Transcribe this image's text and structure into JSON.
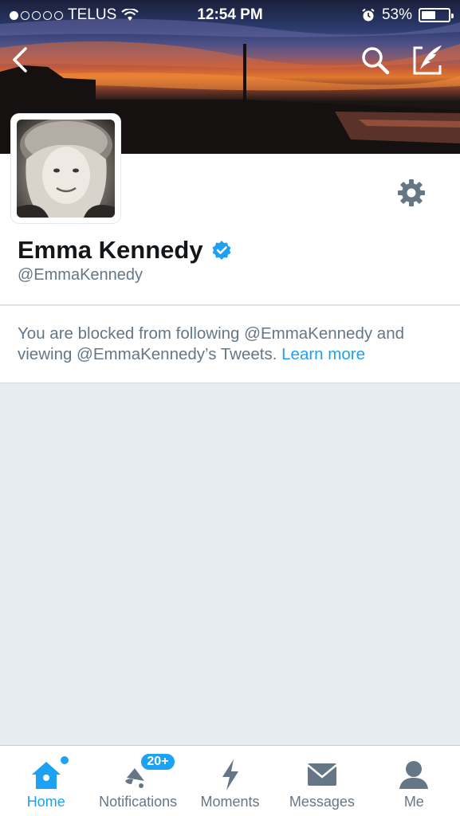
{
  "status_bar": {
    "carrier": "TELUS",
    "time": "12:54 PM",
    "battery": "53%",
    "battery_level": 0.53,
    "signal_bars_filled": 1,
    "signal_bars_total": 5
  },
  "header": {
    "back_icon": "chevron-left-icon",
    "search_icon": "search-icon",
    "compose_icon": "compose-tweet-icon"
  },
  "profile": {
    "name": "Emma Kennedy",
    "handle": "@EmmaKennedy",
    "verified": true,
    "settings_icon": "gear-icon"
  },
  "notice": {
    "text": "You are blocked from following @EmmaKennedy and viewing @EmmaKennedy’s Tweets.",
    "link": "Learn more"
  },
  "tabbar": {
    "tabs": [
      {
        "label": "Home",
        "icon": "home-icon",
        "active": true,
        "dot": true
      },
      {
        "label": "Notifications",
        "icon": "bell-icon",
        "badge": "20+"
      },
      {
        "label": "Moments",
        "icon": "lightning-icon"
      },
      {
        "label": "Messages",
        "icon": "envelope-icon"
      },
      {
        "label": "Me",
        "icon": "person-icon"
      }
    ]
  },
  "colors": {
    "accent": "#1da1f2",
    "muted_text": "#657786",
    "background": "#e6ecf0"
  }
}
